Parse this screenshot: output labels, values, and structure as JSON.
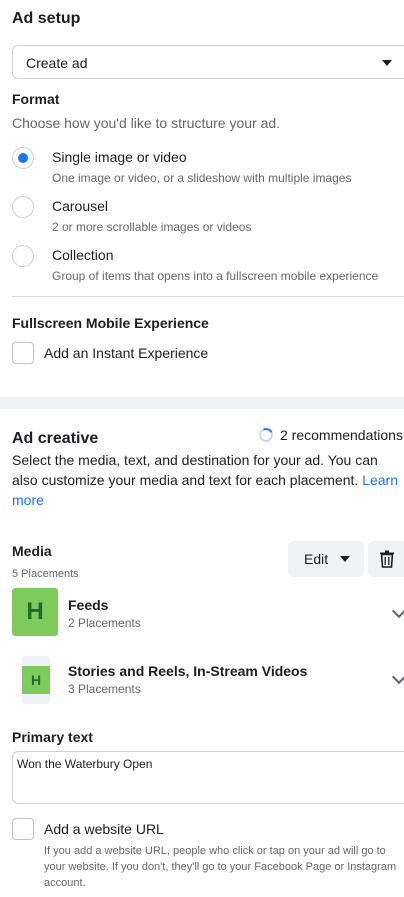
{
  "ad_setup": {
    "title": "Ad setup",
    "dropdown_value": "Create ad"
  },
  "format": {
    "title": "Format",
    "subtitle": "Choose how you'd like to structure your ad.",
    "options": [
      {
        "label": "Single image or video",
        "description": "One image or video, or a slideshow with multiple images",
        "selected": true
      },
      {
        "label": "Carousel",
        "description": "2 or more scrollable images or videos",
        "selected": false
      },
      {
        "label": "Collection",
        "description": "Group of items that opens into a fullscreen mobile experience",
        "selected": false
      }
    ]
  },
  "fullscreen": {
    "title": "Fullscreen Mobile Experience",
    "checkbox_label": "Add an Instant Experience"
  },
  "ad_creative": {
    "title": "Ad creative",
    "recommendations": "2 recommendations",
    "description": "Select the media, text, and destination for your ad. You can also customize your media and text for each placement. ",
    "learn_more": "Learn more"
  },
  "media": {
    "title": "Media",
    "placements": "5 Placements",
    "edit_label": "Edit",
    "groups": [
      {
        "name": "Feeds",
        "placements": "2 Placements",
        "thumb_letter": "H"
      },
      {
        "name": "Stories and Reels, In-Stream Videos",
        "placements": "3 Placements",
        "thumb_letter": "H"
      }
    ]
  },
  "primary_text": {
    "title": "Primary text",
    "value": "Won the Waterbury Open"
  },
  "website": {
    "checkbox_label": "Add a website URL",
    "help": "If you add a website URL, people who click or tap on your ad will go to your website. If you don't, they'll go to your Facebook Page or Instagram account."
  },
  "colors": {
    "accent": "#1877f2",
    "thumb_green": "#7ecb5c"
  }
}
